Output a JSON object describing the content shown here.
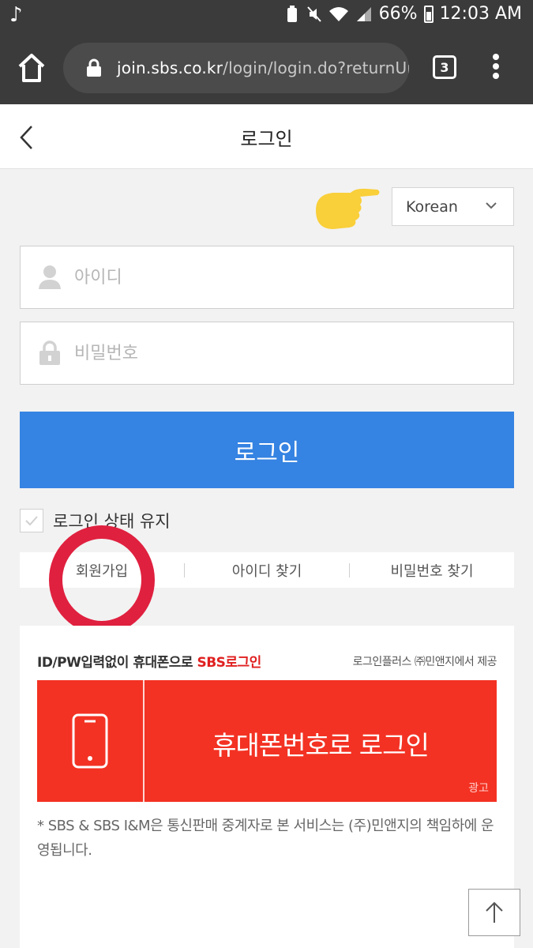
{
  "status_bar": {
    "battery": "66%",
    "time": "12:03 AM"
  },
  "browser": {
    "url_host": "join.sbs.co.kr",
    "url_path": "/login/login.do?returnUr",
    "tab_count": "3"
  },
  "header": {
    "title": "로그인"
  },
  "language": {
    "selected": "Korean"
  },
  "form": {
    "id_placeholder": "아이디",
    "pw_placeholder": "비밀번호",
    "login_label": "로그인",
    "keep_label": "로그인 상태 유지"
  },
  "links": {
    "signup": "회원가입",
    "find_id": "아이디 찾기",
    "find_pw": "비밀번호 찾기"
  },
  "ad": {
    "head_prefix": "ID/PW입력없이 휴대폰으로 ",
    "head_highlight": "SBS로그인",
    "provider": "로그인플러스 ㈜민앤지에서 제공",
    "banner_text": "휴대폰번호로 로그인",
    "tag": "광고",
    "note": "* SBS & SBS I&M은 통신판매 중계자로 본 서비스는 (주)민앤지의 책임하에 운영됩니다."
  },
  "colors": {
    "primary": "#3583e2",
    "ad_red": "#f33223",
    "annotation": "#e0203f"
  },
  "icons": [
    "home-icon",
    "lock-icon",
    "back-icon",
    "chevron-down-icon",
    "user-icon",
    "padlock-icon",
    "check-icon",
    "phone-icon",
    "arrow-up-icon"
  ]
}
